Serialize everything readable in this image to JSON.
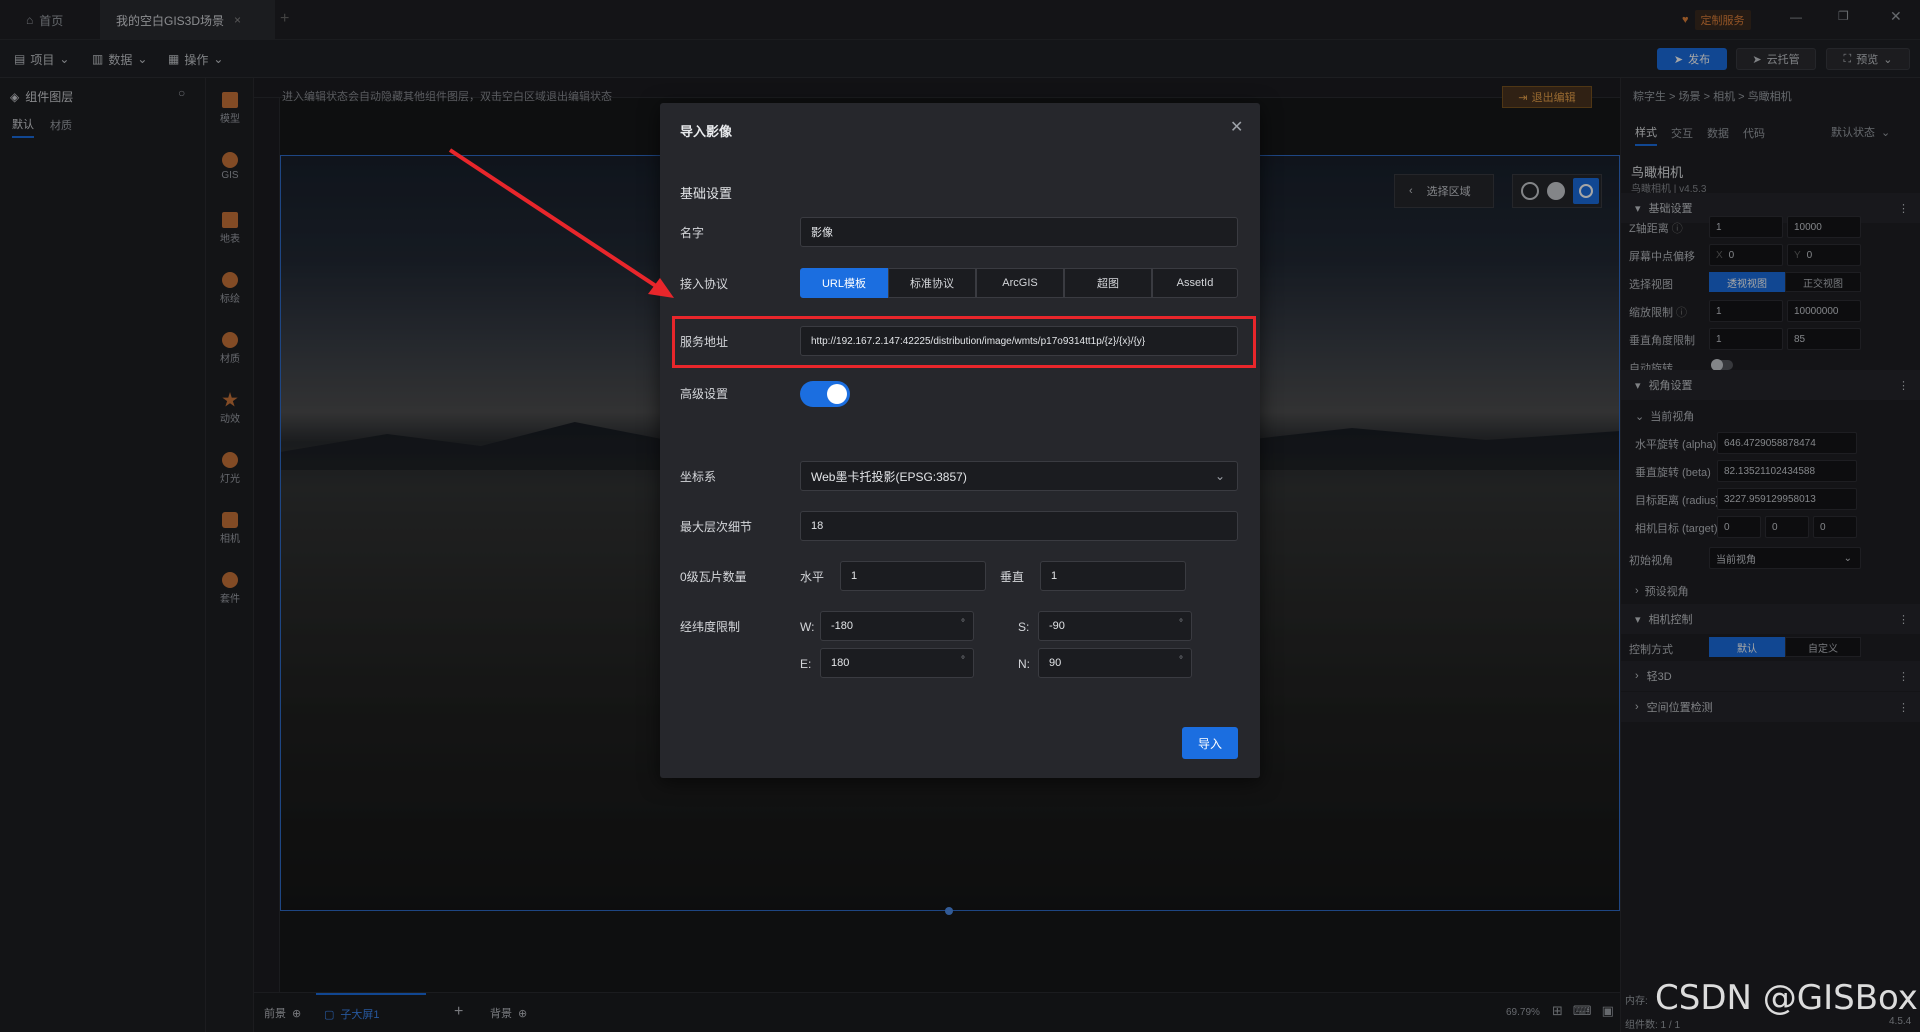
{
  "titlebar": {
    "tabs": [
      {
        "label": "首页"
      },
      {
        "label": "我的空白GIS3D场景"
      }
    ],
    "custom_service": "定制服务"
  },
  "menubar": {
    "items": [
      "项目",
      "数据",
      "操作"
    ],
    "publish": "发布",
    "cloud_host": "云托管",
    "preview": "预览"
  },
  "left_panel": {
    "title": "组件图层",
    "tabs": [
      "默认",
      "材质"
    ]
  },
  "icon_bar": [
    {
      "label": "模型",
      "icon": "cube-icon"
    },
    {
      "label": "GIS",
      "icon": "globe-icon"
    },
    {
      "label": "地表",
      "icon": "terrain-icon"
    },
    {
      "label": "标绘",
      "icon": "pin-icon"
    },
    {
      "label": "材质",
      "icon": "material-icon"
    },
    {
      "label": "动效",
      "icon": "effect-icon"
    },
    {
      "label": "灯光",
      "icon": "light-icon"
    },
    {
      "label": "相机",
      "icon": "camera-icon"
    },
    {
      "label": "套件",
      "icon": "kit-icon"
    }
  ],
  "canvas": {
    "hint": "进入编辑状态会自动隐藏其他组件图层，双击空白区域退出编辑状态",
    "exit_edit": "退出编辑",
    "select_area": "选择区域",
    "zoom": "69.79%",
    "bottom_tabs": [
      "前景",
      "子大屏1",
      "背景"
    ],
    "memory_label": "内存:",
    "component_count": "组件数: 1 / 1",
    "version": "4.5.4",
    "watermark": "CSDN @GISBox"
  },
  "right_panel": {
    "breadcrumb": "粽字生 > 场景 > 相机 > 鸟瞰相机",
    "tabs": [
      "样式",
      "交互",
      "数据",
      "代码"
    ],
    "state": "默认状态",
    "component_name": "鸟瞰相机",
    "component_sub": "鸟瞰相机 | v4.5.3",
    "basic_section": "基础设置",
    "z_distance_label": "Z轴距离",
    "z_min": "1",
    "z_max": "10000",
    "screen_offset_label": "屏幕中点偏移",
    "offset_x_prefix": "X",
    "offset_x": "0",
    "offset_y_prefix": "Y",
    "offset_y": "0",
    "select_view_label": "选择视图",
    "view_perspective": "透视视图",
    "view_ortho": "正交视图",
    "zoom_limit_label": "缩放限制",
    "zoom_min": "1",
    "zoom_max": "10000000",
    "vertical_limit_label": "垂直角度限制",
    "vert_min": "1",
    "vert_max": "85",
    "auto_rotate_label": "自动旋转",
    "view_section": "视角设置",
    "current_view_label": "当前视角",
    "alpha_label": "水平旋转 (alpha)",
    "alpha": "646.4729058878474",
    "beta_label": "垂直旋转 (beta)",
    "beta": "82.13521102434588",
    "radius_label": "目标距离 (radius)",
    "radius": "3227.959129958013",
    "target_label": "相机目标 (target)",
    "target": [
      "0",
      "0",
      "0"
    ],
    "init_view_label": "初始视角",
    "init_view_value": "当前视角",
    "preset_view": "预设视角",
    "camera_control_section": "相机控制",
    "control_mode_label": "控制方式",
    "control_default": "默认",
    "control_custom": "自定义",
    "light3d": "轻3D",
    "space_detect": "空间位置检测"
  },
  "modal": {
    "title": "导入影像",
    "section": "基础设置",
    "name_label": "名字",
    "name_value": "影像",
    "protocol_label": "接入协议",
    "protocols": [
      "URL模板",
      "标准协议",
      "ArcGIS",
      "超图",
      "AssetId"
    ],
    "service_label": "服务地址",
    "service_url": "http://192.167.2.147:42225/distribution/image/wmts/p17o9314tt1p/{z}/{x}/{y}",
    "advanced_label": "高级设置",
    "crs_label": "坐标系",
    "crs_value": "Web墨卡托投影(EPSG:3857)",
    "max_level_label": "最大层次细节",
    "max_level_value": "18",
    "tile_count_label": "0级瓦片数量",
    "horizontal_label": "水平",
    "horizontal_value": "1",
    "vertical_label": "垂直",
    "vertical_value": "1",
    "extent_label": "经纬度限制",
    "w_label": "W:",
    "w_value": "-180",
    "s_label": "S:",
    "s_value": "-90",
    "e_label": "E:",
    "e_value": "180",
    "n_label": "N:",
    "n_value": "90",
    "degree_unit": "°",
    "import_button": "导入"
  },
  "colors": {
    "accent": "#1b6ee0",
    "highlight_box": "#e8262b",
    "arrow": "#e8262b"
  }
}
